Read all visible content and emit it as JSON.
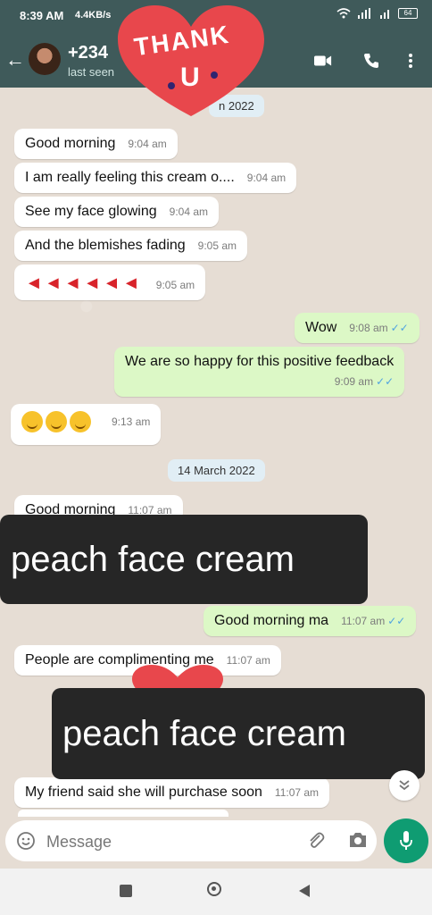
{
  "status_bar": {
    "time": "8:39 AM",
    "net_speed": "4.4KB/s",
    "battery": "64"
  },
  "header": {
    "back_icon": "arrow-left-icon",
    "contact_name": "+234",
    "last_seen": "last seen",
    "video_icon": "video-call-icon",
    "call_icon": "phone-icon",
    "menu_icon": "more-vert-icon"
  },
  "stickers": {
    "thank_you_line1": "THANK",
    "thank_you_line2": "U"
  },
  "chat": {
    "date_top": "n 2022",
    "date_mid": "14 March 2022",
    "messages": [
      {
        "dir": "in",
        "text": "Good morning",
        "time": "9:04 am"
      },
      {
        "dir": "in",
        "text": "I am really feeling this cream o....",
        "time": "9:04 am"
      },
      {
        "dir": "in",
        "text": "See my face glowing",
        "time": "9:04 am"
      },
      {
        "dir": "in",
        "text": "And the blemishes fading",
        "time": "9:05 am"
      },
      {
        "dir": "in",
        "text": "",
        "time": "9:05 am"
      },
      {
        "dir": "out",
        "text": "Wow",
        "time": "9:08 am"
      },
      {
        "dir": "out",
        "text": "We are so happy for this positive feedback",
        "time": "9:09 am"
      },
      {
        "dir": "in",
        "text": "",
        "time": "9:13 am"
      },
      {
        "dir": "in",
        "text": "Good morning",
        "time": "11:07 am"
      },
      {
        "dir": "out",
        "text": "Good morning ma",
        "time": "11:07 am"
      },
      {
        "dir": "in",
        "text": "People are complimenting me",
        "time": "11:07 am"
      },
      {
        "dir": "in",
        "text": "My friend said she will purchase soon",
        "time": "11:07 am"
      }
    ]
  },
  "overlays": {
    "banner1": "peach face cream",
    "banner2": "peach face cream"
  },
  "input": {
    "placeholder": "Message",
    "emoji_icon": "emoji-icon",
    "attach_icon": "paperclip-icon",
    "camera_icon": "camera-icon",
    "mic_icon": "microphone-icon"
  },
  "colors": {
    "header": "#3f5a5a",
    "outgoing_bubble": "#dcf8c6",
    "incoming_bubble": "#ffffff",
    "mic_button": "#0f9c72",
    "heart": "#e8474c"
  }
}
